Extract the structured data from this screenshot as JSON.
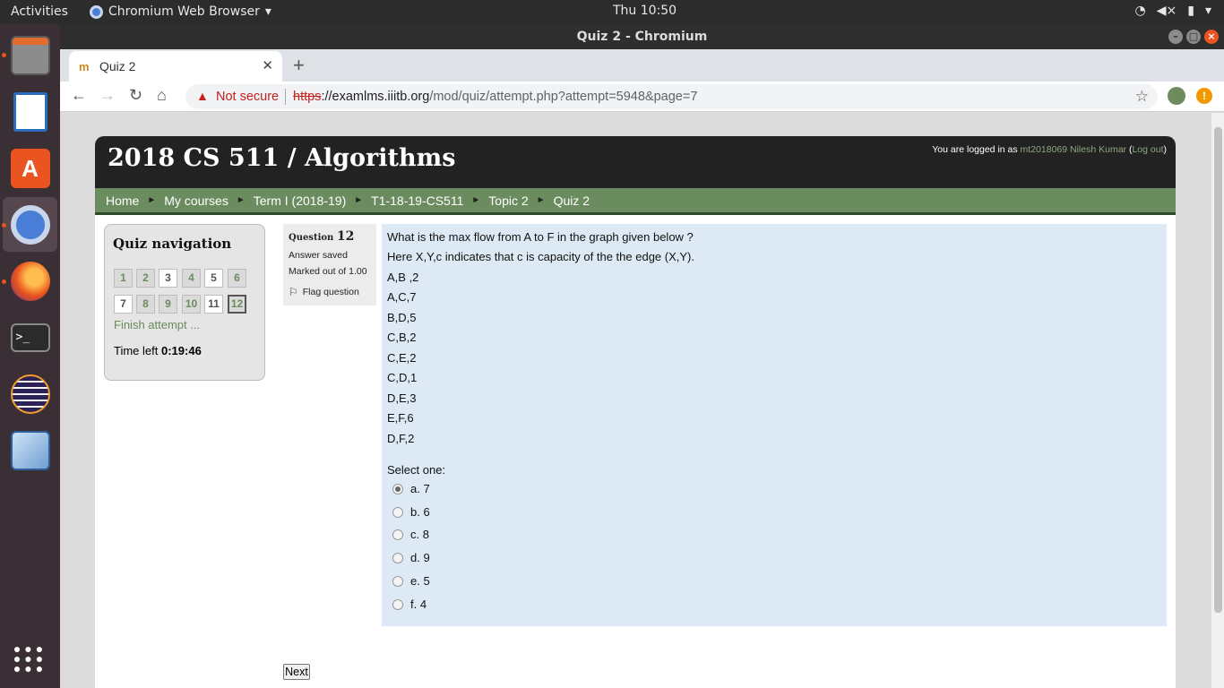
{
  "topbar": {
    "activities": "Activities",
    "app_name": "Chromium Web Browser",
    "clock": "Thu 10:50"
  },
  "window": {
    "title": "Quiz 2 - Chromium"
  },
  "tab": {
    "title": "Quiz 2"
  },
  "omnibox": {
    "not_secure": "Not secure",
    "url_scheme": "https",
    "url_host": "://examlms.iiitb.org",
    "url_path": "/mod/quiz/attempt.php?attempt=5948&page=7"
  },
  "site": {
    "name": "2018 CS 511 / Algorithms",
    "login_prefix": "You are logged in as ",
    "user": "mt2018069 Nilesh Kumar",
    "logout_open": " (",
    "logout": "Log out",
    "logout_close": ")"
  },
  "breadcrumb": [
    "Home",
    "My courses",
    "Term I (2018-19)",
    "T1-18-19-CS511",
    "Topic 2",
    "Quiz 2"
  ],
  "quiz_nav": {
    "title": "Quiz navigation",
    "finish": "Finish attempt ...",
    "time_label": "Time left ",
    "time_value": "0:19:46",
    "buttons": [
      "1",
      "2",
      "3",
      "4",
      "5",
      "6",
      "7",
      "8",
      "9",
      "10",
      "11",
      "12"
    ]
  },
  "question_info": {
    "label": "Question ",
    "number": "12",
    "state": "Answer saved",
    "grade": "Marked out of 1.00",
    "flag": "Flag question"
  },
  "question": {
    "lines": [
      "What is the max flow from A to F in the graph given below ?",
      "Here X,Y,c indicates that c is capacity of the the edge (X,Y).",
      "A,B ,2",
      "A,C,7",
      "B,D,5",
      "C,B,2",
      "C,E,2",
      "C,D,1",
      "D,E,3",
      "E,F,6",
      "D,F,2"
    ],
    "prompt": "Select one:",
    "options": [
      "a. 7",
      "b. 6",
      "c. 8",
      "d. 9",
      "e. 5",
      "f. 4"
    ],
    "selected": "a. 7"
  },
  "next_label": "Next"
}
